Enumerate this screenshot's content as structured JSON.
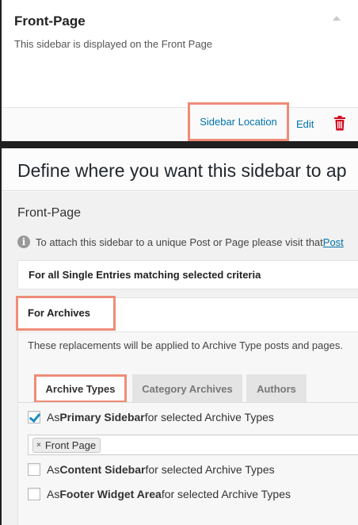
{
  "widget": {
    "title": "Front-Page",
    "description": "This sidebar is displayed on the Front Page",
    "actions": {
      "sidebar_location": "Sidebar Location",
      "edit": "Edit",
      "delete_icon": "trash-icon"
    }
  },
  "modal": {
    "title": "Define where you want this sidebar to ap",
    "sidebar_name": "Front-Page",
    "info": {
      "text": "To attach this sidebar to a unique Post or Page please visit that ",
      "link": "Post",
      "icon": "info-icon"
    },
    "sections": {
      "single": {
        "label": "For all Single Entries matching selected criteria"
      },
      "archives": {
        "label": "For Archives",
        "description": "These replacements will be applied to Archive Type posts and pages.",
        "tabs": [
          {
            "label": "Archive Types",
            "active": true
          },
          {
            "label": "Category Archives",
            "active": false
          },
          {
            "label": "Authors",
            "active": false
          }
        ],
        "options": {
          "primary": {
            "prefix": "As ",
            "bold": "Primary Sidebar",
            "suffix": " for selected Archive Types",
            "checked": true
          },
          "content": {
            "prefix": "As ",
            "bold": "Content Sidebar",
            "suffix": " for selected Archive Types",
            "checked": false
          },
          "footer": {
            "prefix": "As ",
            "bold": "Footer Widget Area",
            "suffix": " for selected Archive Types",
            "checked": false
          }
        },
        "selected_tags": [
          {
            "label": "Front Page",
            "remove": "×"
          }
        ]
      }
    }
  },
  "colors": {
    "highlight": "#ef8c78",
    "link": "#0073aa",
    "delete": "#d0021b"
  }
}
